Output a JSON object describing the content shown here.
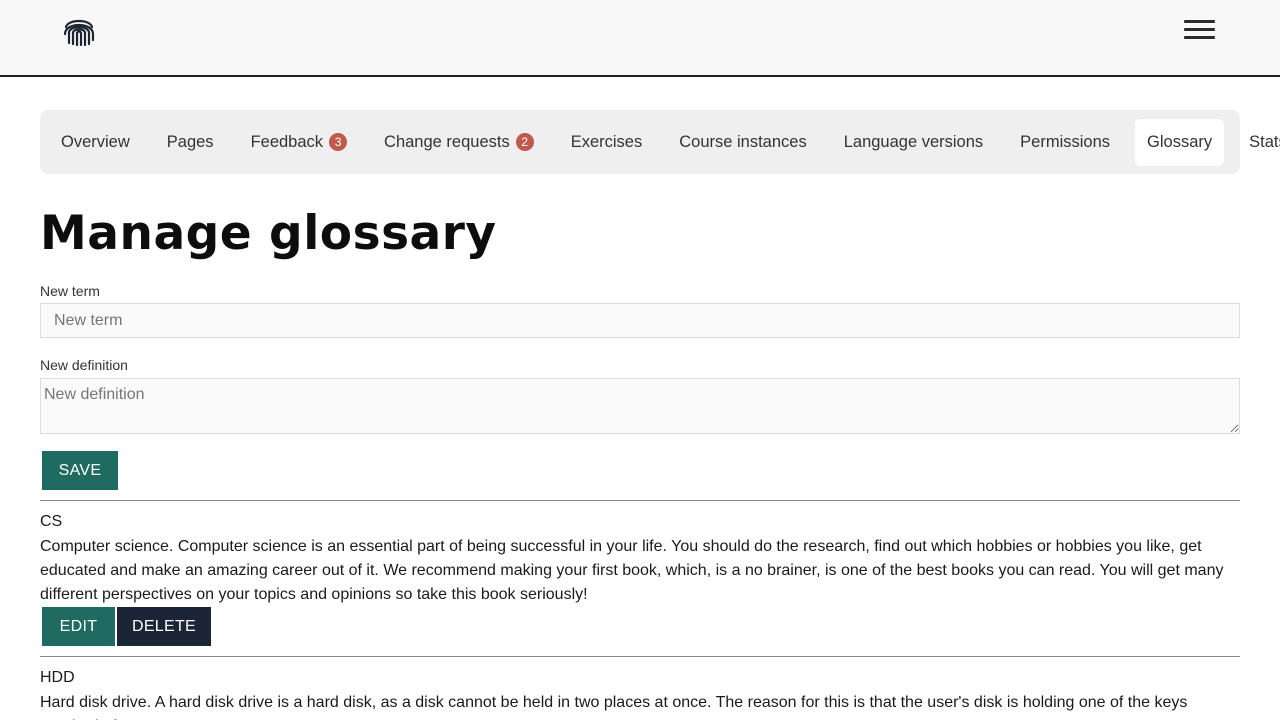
{
  "header": {
    "logo_icon": "fingerprint-icon",
    "menu_icon": "hamburger-menu-icon"
  },
  "tabs": [
    {
      "label": "Overview",
      "badge": null,
      "active": false
    },
    {
      "label": "Pages",
      "badge": null,
      "active": false
    },
    {
      "label": "Feedback",
      "badge": "3",
      "active": false
    },
    {
      "label": "Change requests",
      "badge": "2",
      "active": false
    },
    {
      "label": "Exercises",
      "badge": null,
      "active": false
    },
    {
      "label": "Course instances",
      "badge": null,
      "active": false
    },
    {
      "label": "Language versions",
      "badge": null,
      "active": false
    },
    {
      "label": "Permissions",
      "badge": null,
      "active": false
    },
    {
      "label": "Glossary",
      "badge": null,
      "active": true
    },
    {
      "label": "Stats",
      "badge": null,
      "active": false
    }
  ],
  "page_title": "Manage glossary",
  "form": {
    "term_label": "New term",
    "term_placeholder": "New term",
    "term_value": "",
    "definition_label": "New definition",
    "definition_placeholder": "New definition",
    "definition_value": "",
    "save_label": "SAVE"
  },
  "entries": [
    {
      "term": "CS",
      "definition": "Computer science. Computer science is an essential part of being successful in your life. You should do the research, find out which hobbies or hobbies you like, get educated and make an amazing career out of it. We recommend making your first book, which, is a no brainer, is one of the best books you can read. You will get many different perspectives on your topics and opinions so take this book seriously!",
      "edit_label": "EDIT",
      "delete_label": "DELETE"
    },
    {
      "term": "HDD",
      "definition": "Hard disk drive. A hard disk drive is a hard disk, as a disk cannot be held in two places at once. The reason for this is that the user's disk is holding one of the keys required of"
    }
  ],
  "colors": {
    "primary_button": "#1f6b62",
    "secondary_button": "#1c2538",
    "badge": "#bf5a4e",
    "tab_bar": "#efefef"
  }
}
